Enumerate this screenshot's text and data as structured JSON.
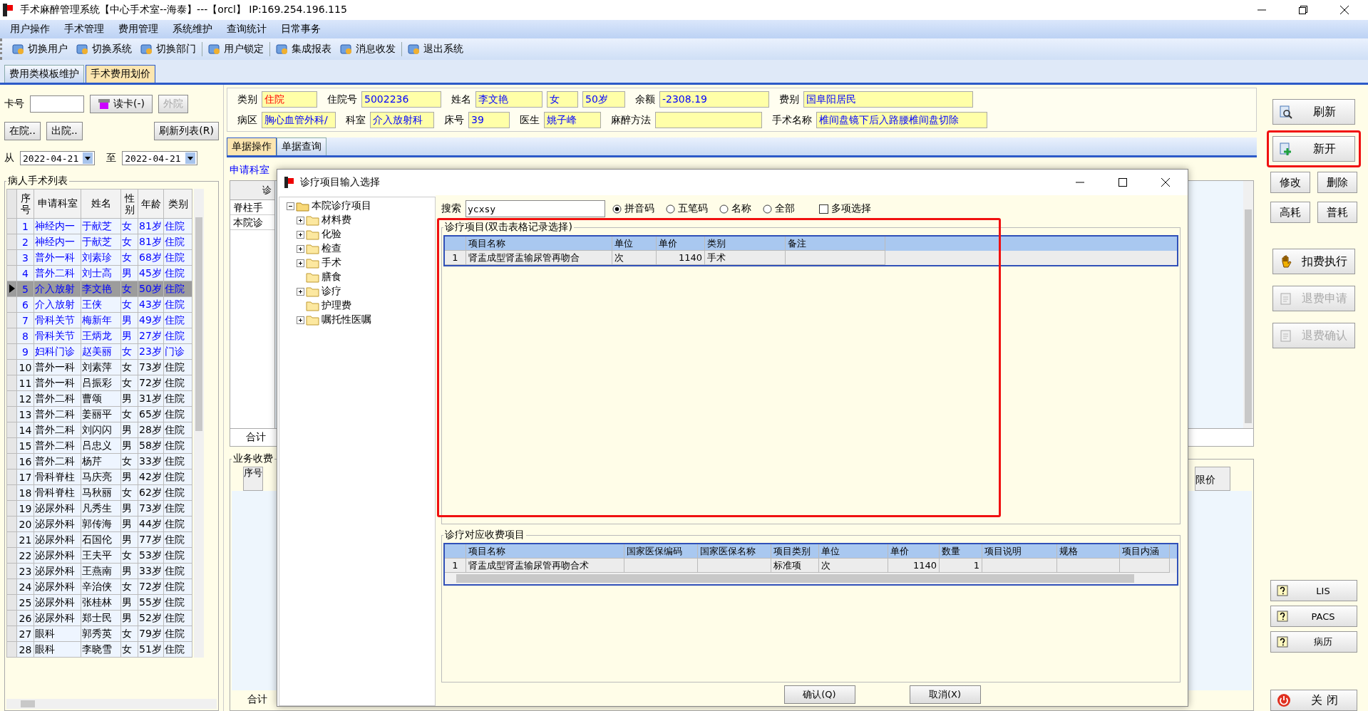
{
  "window": {
    "title": "手术麻醉管理系统【中心手术室--海泰】---【orcl】 IP:169.254.196.115"
  },
  "menu": [
    "用户操作",
    "手术管理",
    "费用管理",
    "系统维护",
    "查询统计",
    "日常事务"
  ],
  "toolbar": [
    "切换用户",
    "切换系统",
    "切换部门",
    "用户锁定",
    "集成报表",
    "消息收发",
    "退出系统"
  ],
  "tabs": [
    {
      "label": "费用类模板维护",
      "selected": false
    },
    {
      "label": "手术费用划价",
      "selected": true
    }
  ],
  "card_panel": {
    "card_label": "卡号",
    "read_card_button": "读卡(-)",
    "external_button": {
      "label": "外院",
      "disabled": true
    },
    "buttons": [
      "在院..",
      "出院..",
      "刷新列表(R)"
    ],
    "from_label": "从",
    "date_from": "2022-04-21",
    "to_label": "至",
    "date_to": "2022-04-21"
  },
  "patient_list": {
    "title": "病人手术列表",
    "columns": [
      "序号",
      "申请科室",
      "姓名",
      "性别",
      "年龄",
      "类别"
    ],
    "rows": [
      {
        "cells": [
          "1",
          "神经内一",
          "于献芝",
          "女",
          "81岁",
          "住院"
        ],
        "flagged": true,
        "selected": false
      },
      {
        "cells": [
          "2",
          "神经内一",
          "于献芝",
          "女",
          "81岁",
          "住院"
        ],
        "flagged": true,
        "selected": false
      },
      {
        "cells": [
          "3",
          "普外一科",
          "刘素珍",
          "女",
          "68岁",
          "住院"
        ],
        "flagged": true,
        "selected": false
      },
      {
        "cells": [
          "4",
          "普外二科",
          "刘士高",
          "男",
          "45岁",
          "住院"
        ],
        "flagged": true,
        "selected": false
      },
      {
        "cells": [
          "5",
          "介入放射",
          "李文艳",
          "女",
          "50岁",
          "住院"
        ],
        "flagged": true,
        "selected": true
      },
      {
        "cells": [
          "6",
          "介入放射",
          "王侠",
          "女",
          "43岁",
          "住院"
        ],
        "flagged": true,
        "selected": false
      },
      {
        "cells": [
          "7",
          "骨科关节",
          "梅新年",
          "男",
          "49岁",
          "住院"
        ],
        "flagged": true,
        "selected": false
      },
      {
        "cells": [
          "8",
          "骨科关节",
          "王炳龙",
          "男",
          "27岁",
          "住院"
        ],
        "flagged": true,
        "selected": false
      },
      {
        "cells": [
          "9",
          "妇科门诊",
          "赵美丽",
          "女",
          "23岁",
          "门诊"
        ],
        "flagged": true,
        "selected": false
      },
      {
        "cells": [
          "10",
          "普外一科",
          "刘素萍",
          "女",
          "73岁",
          "住院"
        ],
        "flagged": false,
        "selected": false
      },
      {
        "cells": [
          "11",
          "普外一科",
          "吕振彩",
          "女",
          "72岁",
          "住院"
        ],
        "flagged": false,
        "selected": false
      },
      {
        "cells": [
          "12",
          "普外二科",
          "曹颂",
          "男",
          "31岁",
          "住院"
        ],
        "flagged": false,
        "selected": false
      },
      {
        "cells": [
          "13",
          "普外二科",
          "姜丽平",
          "女",
          "65岁",
          "住院"
        ],
        "flagged": false,
        "selected": false
      },
      {
        "cells": [
          "14",
          "普外二科",
          "刘闪闪",
          "男",
          "28岁",
          "住院"
        ],
        "flagged": false,
        "selected": false
      },
      {
        "cells": [
          "15",
          "普外二科",
          "吕忠义",
          "男",
          "58岁",
          "住院"
        ],
        "flagged": false,
        "selected": false
      },
      {
        "cells": [
          "16",
          "普外二科",
          "杨芹",
          "女",
          "33岁",
          "住院"
        ],
        "flagged": false,
        "selected": false
      },
      {
        "cells": [
          "17",
          "骨科脊柱",
          "马庆亮",
          "男",
          "42岁",
          "住院"
        ],
        "flagged": false,
        "selected": false
      },
      {
        "cells": [
          "18",
          "骨科脊柱",
          "马秋丽",
          "女",
          "62岁",
          "住院"
        ],
        "flagged": false,
        "selected": false
      },
      {
        "cells": [
          "19",
          "泌尿外科",
          "凡秀生",
          "男",
          "73岁",
          "住院"
        ],
        "flagged": false,
        "selected": false
      },
      {
        "cells": [
          "20",
          "泌尿外科",
          "郭传海",
          "男",
          "44岁",
          "住院"
        ],
        "flagged": false,
        "selected": false
      },
      {
        "cells": [
          "21",
          "泌尿外科",
          "石国伦",
          "男",
          "77岁",
          "住院"
        ],
        "flagged": false,
        "selected": false
      },
      {
        "cells": [
          "22",
          "泌尿外科",
          "王夫平",
          "女",
          "53岁",
          "住院"
        ],
        "flagged": false,
        "selected": false
      },
      {
        "cells": [
          "23",
          "泌尿外科",
          "王燕南",
          "男",
          "33岁",
          "住院"
        ],
        "flagged": false,
        "selected": false
      },
      {
        "cells": [
          "24",
          "泌尿外科",
          "辛治侠",
          "女",
          "72岁",
          "住院"
        ],
        "flagged": false,
        "selected": false
      },
      {
        "cells": [
          "25",
          "泌尿外科",
          "张桂林",
          "男",
          "55岁",
          "住院"
        ],
        "flagged": false,
        "selected": false
      },
      {
        "cells": [
          "26",
          "泌尿外科",
          "郑士民",
          "男",
          "52岁",
          "住院"
        ],
        "flagged": false,
        "selected": false
      },
      {
        "cells": [
          "27",
          "眼科",
          "郭秀英",
          "女",
          "79岁",
          "住院"
        ],
        "flagged": false,
        "selected": false
      },
      {
        "cells": [
          "28",
          "眼科",
          "李晓雪",
          "女",
          "51岁",
          "住院"
        ],
        "flagged": false,
        "selected": false
      }
    ]
  },
  "patient_info": {
    "fields": [
      {
        "label": "类别",
        "value": "住院",
        "warning": true
      },
      {
        "label": "住院号",
        "value": "5002236",
        "warning": false
      },
      {
        "label": "姓名",
        "value": "李文艳",
        "warning": false
      },
      {
        "value": "女",
        "warning": false
      },
      {
        "value": "50岁",
        "warning": false
      },
      {
        "label": "余额",
        "value": "-2308.19",
        "warning": false
      },
      {
        "label": "费别",
        "value": "国阜阳居民",
        "warning": false
      },
      {
        "label": "病区",
        "value": "胸心血管外科/",
        "warning": false
      },
      {
        "label": "科室",
        "value": "介入放射科",
        "warning": false
      },
      {
        "label": "床号",
        "value": "39",
        "warning": false
      },
      {
        "label": "医生",
        "value": "姚子峰",
        "warning": false
      },
      {
        "label": "麻醉方法"
      },
      {
        "label": "手术名称",
        "value": "椎间盘镜下后入路腰椎间盘切除",
        "warning": false
      }
    ]
  },
  "doc_tabs": [
    {
      "label": "单据操作",
      "selected": true
    },
    {
      "label": "单据查询",
      "selected": false
    }
  ],
  "document": {
    "filter_label": "申请科室",
    "grid_header": "诊",
    "grid_rows": [
      "脊柱手",
      "本院诊"
    ],
    "total_label": "合计",
    "charge_title": "业务收费",
    "charge_first_column": "序号",
    "charge_last_column": "限价",
    "charge_total_label": "合计"
  },
  "dialog": {
    "title": "诊疗项目输入选择",
    "tree": {
      "label": "本院诊疗项目",
      "expanded": true,
      "children": [
        {
          "label": "材料费",
          "expandable": true
        },
        {
          "label": "化验",
          "expandable": true
        },
        {
          "label": "检查",
          "expandable": true
        },
        {
          "label": "手术",
          "expandable": true
        },
        {
          "label": "膳食",
          "expandable": false
        },
        {
          "label": "诊疗",
          "expandable": true
        },
        {
          "label": "护理费",
          "expandable": false
        },
        {
          "label": "嘱托性医嘱",
          "expandable": true
        }
      ]
    },
    "search": {
      "label": "搜索",
      "value": "ycxsy"
    },
    "modes": [
      {
        "label": "拼音码",
        "selected": true
      },
      {
        "label": "五笔码",
        "selected": false
      },
      {
        "label": "名称",
        "selected": false
      },
      {
        "label": "全部",
        "selected": false
      }
    ],
    "multi_select": {
      "label": "多项选择",
      "checked": false
    },
    "items": {
      "title": "诊疗项目(双击表格记录选择)",
      "highlighted": true,
      "columns": [
        "项目名称",
        "单位",
        "单价",
        "类别",
        "备注"
      ],
      "rows": [
        {
          "index": "1",
          "cells": [
            "肾盂成型肾盂输尿管再吻合",
            "次",
            "1140",
            "手术",
            null
          ]
        }
      ]
    },
    "charges": {
      "title": "诊疗对应收费项目",
      "columns": [
        "项目名称",
        "国家医保编码",
        "国家医保名称",
        "项目类别",
        "单位",
        "单价",
        "数量",
        "项目说明",
        "规格",
        "项目内涵"
      ],
      "rows": [
        {
          "index": "1",
          "cells": [
            "肾盂成型肾盂输尿管再吻合术",
            null,
            null,
            "标准项",
            "次",
            "1140",
            "1",
            null,
            null,
            null
          ]
        }
      ]
    },
    "buttons": [
      "确认(Q)",
      "取消(X)"
    ]
  },
  "side_buttons": {
    "top": [
      {
        "label": "刷新",
        "kind": "wide",
        "disabled": false,
        "highlighted": false
      },
      {
        "label": "新开",
        "kind": "wide",
        "disabled": false,
        "highlighted": true
      },
      {
        "label": "修改",
        "kind": "half",
        "disabled": false,
        "highlighted": false
      },
      {
        "label": "删除",
        "kind": "half",
        "disabled": false,
        "highlighted": false
      },
      {
        "label": "高耗",
        "kind": "half",
        "disabled": false,
        "highlighted": false
      },
      {
        "label": "普耗",
        "kind": "half",
        "disabled": false,
        "highlighted": false
      },
      {
        "label": "扣费执行",
        "kind": "action",
        "disabled": false,
        "highlighted": false
      },
      {
        "label": "退费申请",
        "kind": "action",
        "disabled": true,
        "highlighted": false
      },
      {
        "label": "退费确认",
        "kind": "action",
        "disabled": true,
        "highlighted": false
      }
    ],
    "bottom": [
      "LIS",
      "PACS",
      "病历"
    ],
    "close": "关 闭"
  }
}
